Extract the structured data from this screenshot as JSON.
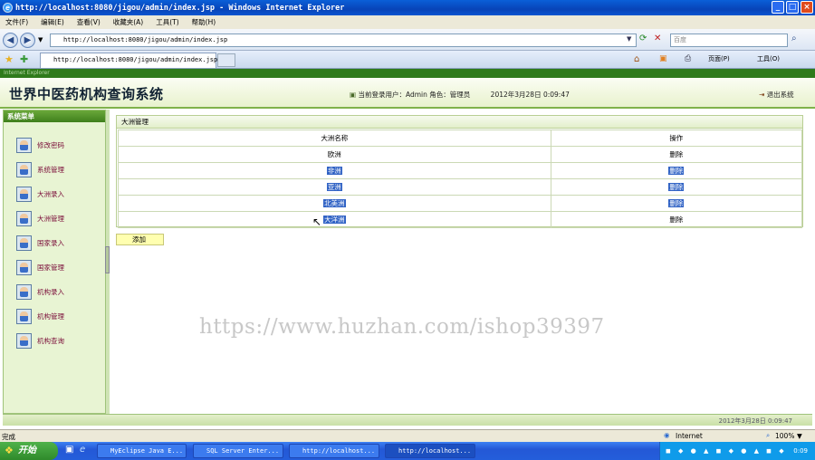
{
  "window": {
    "title": "http://localhost:8080/jigou/admin/index.jsp - Windows Internet Explorer"
  },
  "menubar": [
    "文件(F)",
    "编辑(E)",
    "查看(V)",
    "收藏夹(A)",
    "工具(T)",
    "帮助(H)"
  ],
  "address": {
    "url": "http://localhost:8080/jigou/admin/index.jsp",
    "search_placeholder": "百度"
  },
  "tab": {
    "title": "http://localhost:8080/jigou/admin/index.jsp"
  },
  "toolbar": {
    "page_label": "页面(P)",
    "tools_label": "工具(O)"
  },
  "header": {
    "strip_text": "Internet Explorer",
    "system_title": "世界中医药机构查询系统",
    "user_info": "当前登录用户：Admin 角色：管理员",
    "date_time": "2012年3月28日  0:09:47",
    "exit_label": "退出系统"
  },
  "sidebar": {
    "title": "系统菜单",
    "items": [
      "修改密码",
      "系统管理",
      "大洲录入",
      "大洲管理",
      "国家录入",
      "国家管理",
      "机构录入",
      "机构管理",
      "机构查询"
    ]
  },
  "panel": {
    "title": "大洲管理",
    "columns": [
      "大洲名称",
      "操作"
    ],
    "rows": [
      {
        "name": "欧洲",
        "action": "删除"
      },
      {
        "name": "非洲",
        "action": "删除"
      },
      {
        "name": "亚洲",
        "action": "删除"
      },
      {
        "name": "北美洲",
        "action": "删除"
      },
      {
        "name": "大洋洲",
        "action": "删除"
      }
    ],
    "add_label": "添加"
  },
  "watermark": "https://www.huzhan.com/ishop39397",
  "footer": {
    "date_time": "2012年3月28日  0:09:47"
  },
  "statusbar": {
    "left": "完成",
    "zone": "Internet",
    "zoom": "100%"
  },
  "taskbar": {
    "start_label": "开始",
    "tasks": [
      "MyEclipse Java E...",
      "SQL Server Enter...",
      "http://localhost...",
      "http://localhost..."
    ],
    "clock": "0:09"
  }
}
